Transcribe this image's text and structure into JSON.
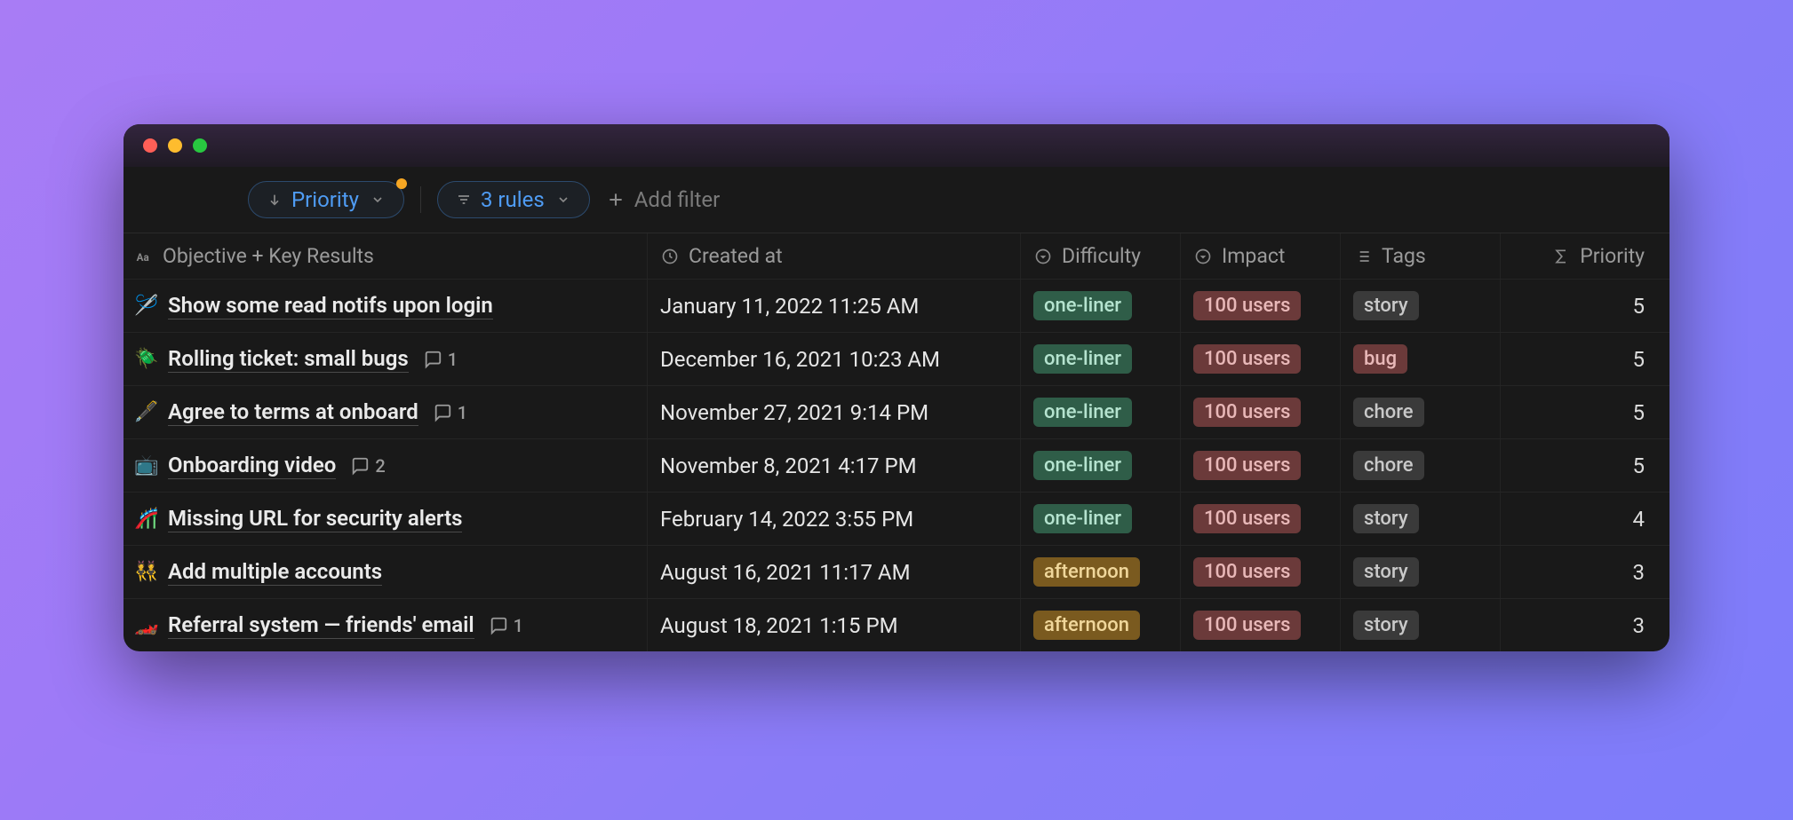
{
  "toolbar": {
    "sort_label": "Priority",
    "sort_has_notif": true,
    "rules_label": "3 rules",
    "add_filter_label": "Add filter"
  },
  "columns": {
    "title": "Objective + Key Results",
    "created_at": "Created at",
    "difficulty": "Difficulty",
    "impact": "Impact",
    "tags": "Tags",
    "priority": "Priority"
  },
  "rows": [
    {
      "emoji": "🪡",
      "title": "Show some read notifs upon login",
      "comments": null,
      "created_at": "January 11, 2022 11:25 AM",
      "difficulty": {
        "label": "one-liner",
        "color": "green"
      },
      "impact": {
        "label": "100 users",
        "color": "brown"
      },
      "tag": {
        "label": "story",
        "color": "gray"
      },
      "priority": "5"
    },
    {
      "emoji": "🪲",
      "title": "Rolling ticket: small bugs",
      "comments": "1",
      "created_at": "December 16, 2021 10:23 AM",
      "difficulty": {
        "label": "one-liner",
        "color": "green"
      },
      "impact": {
        "label": "100 users",
        "color": "brown"
      },
      "tag": {
        "label": "bug",
        "color": "brown"
      },
      "priority": "5"
    },
    {
      "emoji": "🖋️",
      "title": "Agree to terms at onboard",
      "comments": "1",
      "created_at": "November 27, 2021 9:14 PM",
      "difficulty": {
        "label": "one-liner",
        "color": "green"
      },
      "impact": {
        "label": "100 users",
        "color": "brown"
      },
      "tag": {
        "label": "chore",
        "color": "gray"
      },
      "priority": "5"
    },
    {
      "emoji": "📺",
      "title": "Onboarding video",
      "comments": "2",
      "created_at": "November 8, 2021 4:17 PM",
      "difficulty": {
        "label": "one-liner",
        "color": "green"
      },
      "impact": {
        "label": "100 users",
        "color": "brown"
      },
      "tag": {
        "label": "chore",
        "color": "gray"
      },
      "priority": "5"
    },
    {
      "emoji": "🎢",
      "title": "Missing URL for security alerts",
      "comments": null,
      "created_at": "February 14, 2022 3:55 PM",
      "difficulty": {
        "label": "one-liner",
        "color": "green"
      },
      "impact": {
        "label": "100 users",
        "color": "brown"
      },
      "tag": {
        "label": "story",
        "color": "gray"
      },
      "priority": "4"
    },
    {
      "emoji": "👯",
      "title": "Add multiple accounts",
      "comments": null,
      "created_at": "August 16, 2021 11:17 AM",
      "difficulty": {
        "label": "afternoon",
        "color": "gold"
      },
      "impact": {
        "label": "100 users",
        "color": "brown"
      },
      "tag": {
        "label": "story",
        "color": "gray"
      },
      "priority": "3"
    },
    {
      "emoji": "🏎️",
      "title": "Referral system — friends' email",
      "comments": "1",
      "created_at": "August 18, 2021 1:15 PM",
      "difficulty": {
        "label": "afternoon",
        "color": "gold"
      },
      "impact": {
        "label": "100 users",
        "color": "brown"
      },
      "tag": {
        "label": "story",
        "color": "gray"
      },
      "priority": "3"
    }
  ]
}
